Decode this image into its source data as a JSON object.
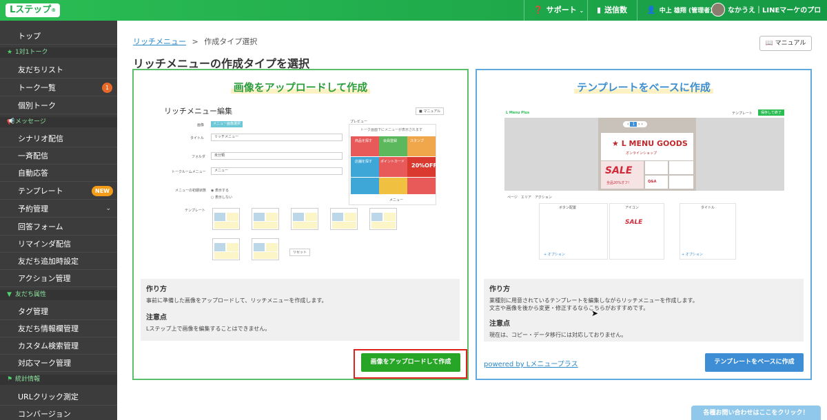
{
  "topbar": {
    "logo": "Lステップ",
    "support": "サポート",
    "send_count": "送信数",
    "user": "中上 雄翔 (管理者)",
    "account": "なかうえ｜LINEマーケのプロ"
  },
  "sidebar": {
    "top": "トップ",
    "sections": [
      {
        "head": "1対1トーク",
        "items": [
          "友だちリスト",
          "トーク一覧",
          "個別トーク"
        ]
      },
      {
        "head": "メッセージ",
        "items": [
          "シナリオ配信",
          "一斉配信",
          "自動応答",
          "テンプレート",
          "予約管理",
          "回答フォーム",
          "リマインダ配信",
          "友だち追加時設定",
          "アクション管理"
        ]
      },
      {
        "head": "友だち属性",
        "items": [
          "タグ管理",
          "友だち情報欄管理",
          "カスタム検索管理",
          "対応マーク管理"
        ]
      },
      {
        "head": "統計情報",
        "items": [
          "URLクリック測定",
          "コンバージョン"
        ]
      }
    ],
    "talk_badge": "1",
    "template_badge": "NEW"
  },
  "breadcrumb": {
    "link": "リッチメニュー",
    "sep": ">",
    "current": "作成タイプ選択"
  },
  "page_title": "リッチメニューの作成タイプを選択",
  "manual_label": "マニュアル",
  "upload_card": {
    "title": "画像をアップロードして作成",
    "how_title": "作り方",
    "how_text": "事前に準備した画像をアップロードして、リッチメニューを作成します。",
    "note_title": "注意点",
    "note_text": "Lステップ上で画像を編集することはできません。",
    "button": "画像をアップロードして作成",
    "preview": {
      "title": "リッチメニュー編集",
      "manual": "マニュアル",
      "image_label": "画像",
      "image_button": "メニュー画像選択",
      "title_label": "タイトル",
      "title_value": "リッチメニュー",
      "folder_label": "フォルダ",
      "folder_value": "未分類",
      "talk_label": "トークルームメニュー",
      "talk_value": "メニュー",
      "initial_label": "メニューの初期状態",
      "show": "表示する",
      "hide": "表示しない",
      "template_label": "テンプレート",
      "reset": "リセット",
      "preview_label": "プレビュー",
      "preview_hint": "トーク画面下にメニューが表示されます",
      "menu_bar": "メニュー",
      "cells": [
        "商品を探す",
        "会員登録",
        "スタンプ",
        "店舗を探す",
        "ポイントカード",
        "20%OFF"
      ]
    }
  },
  "template_card": {
    "title": "テンプレートをベースに作成",
    "how_title": "作り方",
    "how_text_1": "業種別に用意されているテンプレートを編集しながらリッチメニューを作成します。",
    "how_text_2": "文言や画像を後から変更・修正するならこちらがおすすめです。",
    "note_title": "注意点",
    "note_text": "現在は、コピー・データ移行には対応しておりません。",
    "button": "テンプレートをベースに作成",
    "powered": "powered by Lメニュープラス",
    "preview": {
      "brand": "L Menu Plus",
      "tab_template": "テンプレート",
      "save": "保存して終了",
      "goods": "L MENU GOODS",
      "goods_sub": "オンラインショップ",
      "sale": "SALE",
      "sale_sub": "全品20%オフ!",
      "qa": "Q&A",
      "panel_headers": [
        "ボタン配置",
        "アイコン",
        "タイトル"
      ],
      "tabs": [
        "ページ",
        "エリア",
        "アクション"
      ],
      "pager": "1",
      "option": "オプション"
    }
  },
  "contact_button": "各種お問い合わせはここをクリック！",
  "colors": {
    "brand_green": "#1fa94b",
    "cta_green": "#27a527",
    "cta_blue": "#3d8ed4",
    "highlight_red": "#e0201b"
  }
}
